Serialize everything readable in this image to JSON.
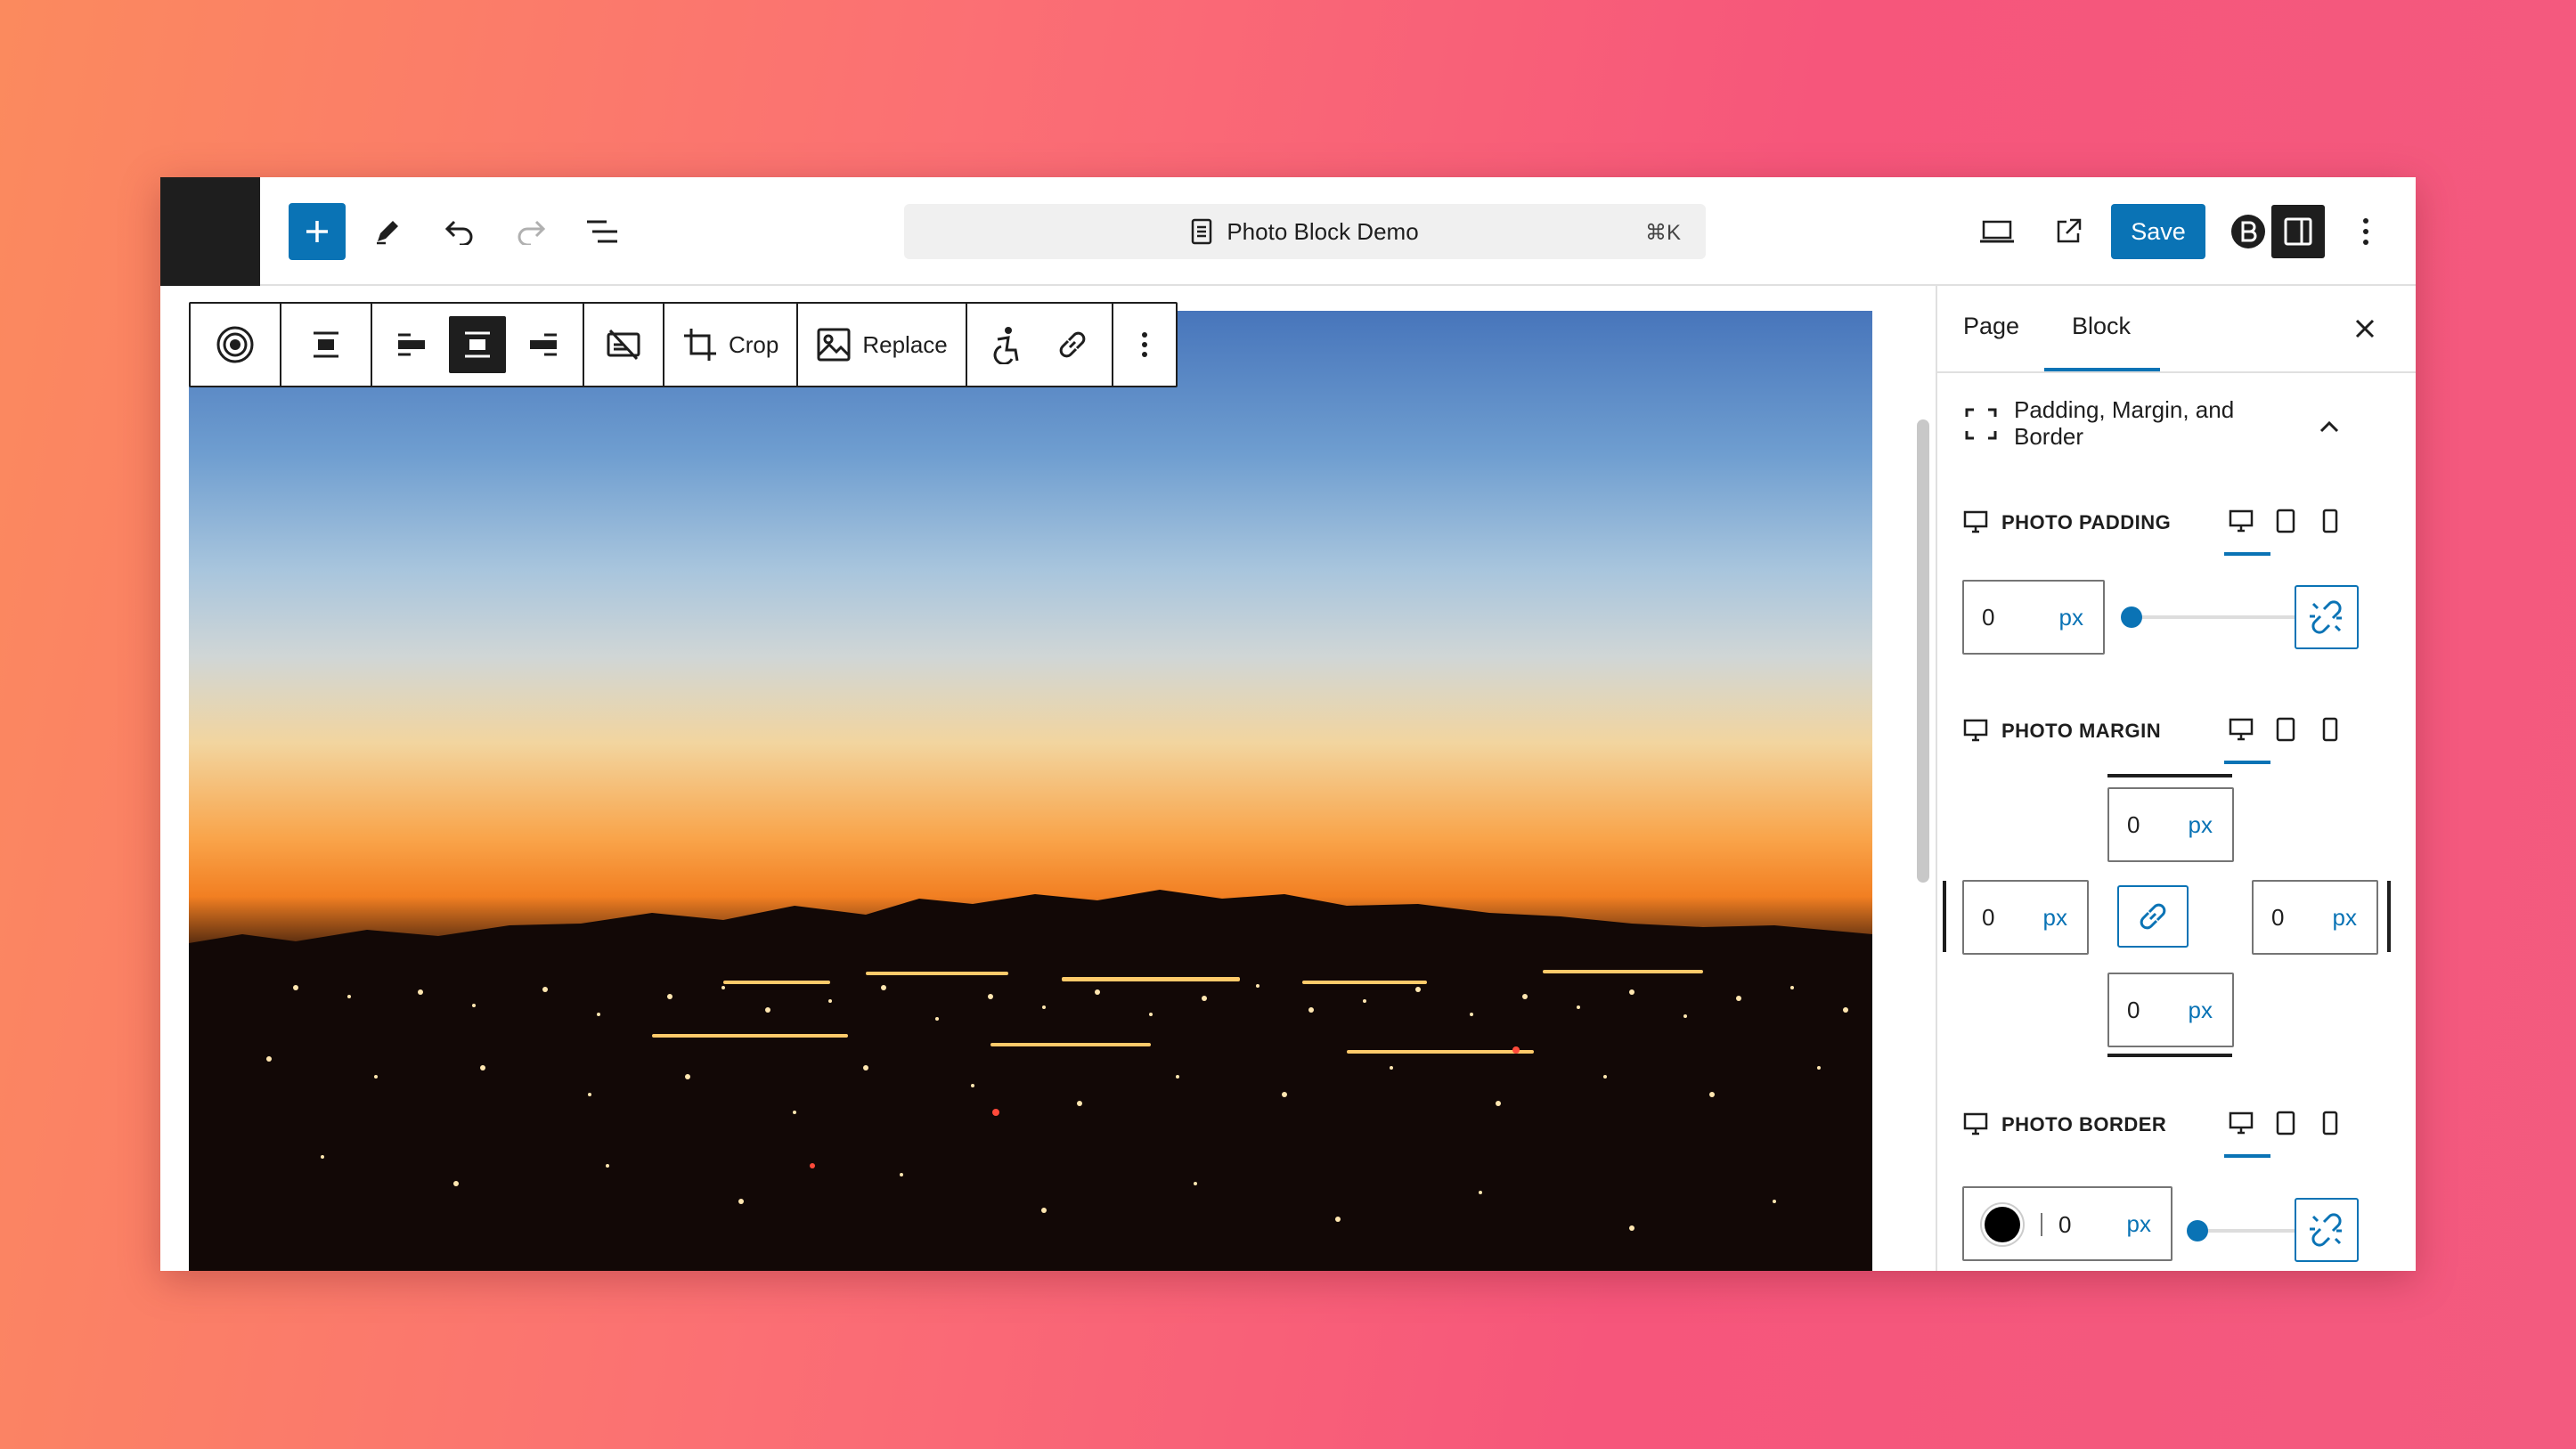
{
  "header": {
    "document_title": "Photo Block Demo",
    "shortcut": "⌘K",
    "save_label": "Save"
  },
  "block_toolbar": {
    "crop_label": "Crop",
    "replace_label": "Replace"
  },
  "sidebar": {
    "tabs": [
      {
        "label": "Page",
        "active": false
      },
      {
        "label": "Block",
        "active": true
      }
    ],
    "section_title": "Padding, Margin, and Border",
    "padding": {
      "label": "PHOTO PADDING",
      "value": "0",
      "unit": "px",
      "slider_fraction": 0
    },
    "margin": {
      "label": "PHOTO MARGIN",
      "top": {
        "value": "0",
        "unit": "px"
      },
      "left": {
        "value": "0",
        "unit": "px"
      },
      "right": {
        "value": "0",
        "unit": "px"
      },
      "bottom": {
        "value": "0",
        "unit": "px"
      }
    },
    "border": {
      "label": "PHOTO BORDER",
      "color": "#000000",
      "value": "0",
      "unit": "px",
      "slider_fraction": 0
    }
  },
  "colors": {
    "accent": "#0a73b5",
    "dark": "#1e1e1e"
  }
}
